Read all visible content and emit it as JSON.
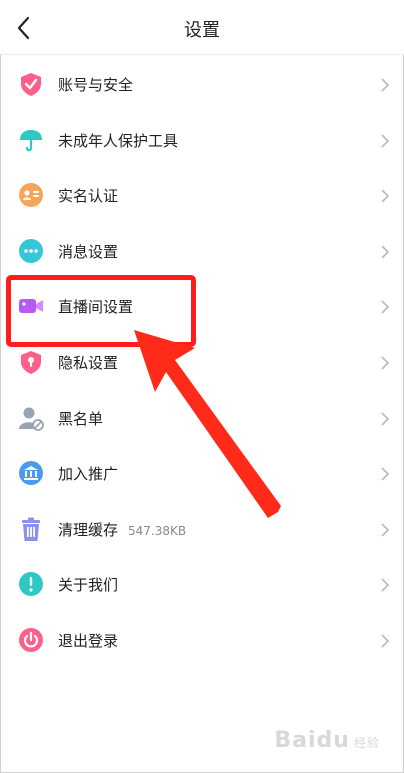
{
  "header": {
    "title": "设置"
  },
  "items": [
    {
      "label": "账号与安全",
      "sub": "",
      "icon": "shield-check-icon",
      "color": "#ff5f8a"
    },
    {
      "label": "未成年人保护工具",
      "sub": "",
      "icon": "umbrella-icon",
      "color": "#2ec9c3"
    },
    {
      "label": "实名认证",
      "sub": "",
      "icon": "id-card-icon",
      "color": "#f7a45c"
    },
    {
      "label": "消息设置",
      "sub": "",
      "icon": "chat-bubble-icon",
      "color": "#35c6d8"
    },
    {
      "label": "直播间设置",
      "sub": "",
      "icon": "video-camera-icon",
      "color": "#b45cf2"
    },
    {
      "label": "隐私设置",
      "sub": "",
      "icon": "privacy-lock-icon",
      "color": "#ff5f8a"
    },
    {
      "label": "黑名单",
      "sub": "",
      "icon": "blocked-user-icon",
      "color": "#9aa3b5"
    },
    {
      "label": "加入推广",
      "sub": "",
      "icon": "building-icon",
      "color": "#4a9bf0"
    },
    {
      "label": "清理缓存",
      "sub": "547.38KB",
      "icon": "trash-icon",
      "color": "#8c8ff0"
    },
    {
      "label": "关于我们",
      "sub": "",
      "icon": "info-icon",
      "color": "#2ec9c3"
    },
    {
      "label": "退出登录",
      "sub": "",
      "icon": "power-icon",
      "color": "#ff5f8a"
    }
  ],
  "watermark": {
    "text": "Baidu",
    "sub": "经验"
  },
  "colors": {
    "highlight": "#ff1d1d"
  }
}
